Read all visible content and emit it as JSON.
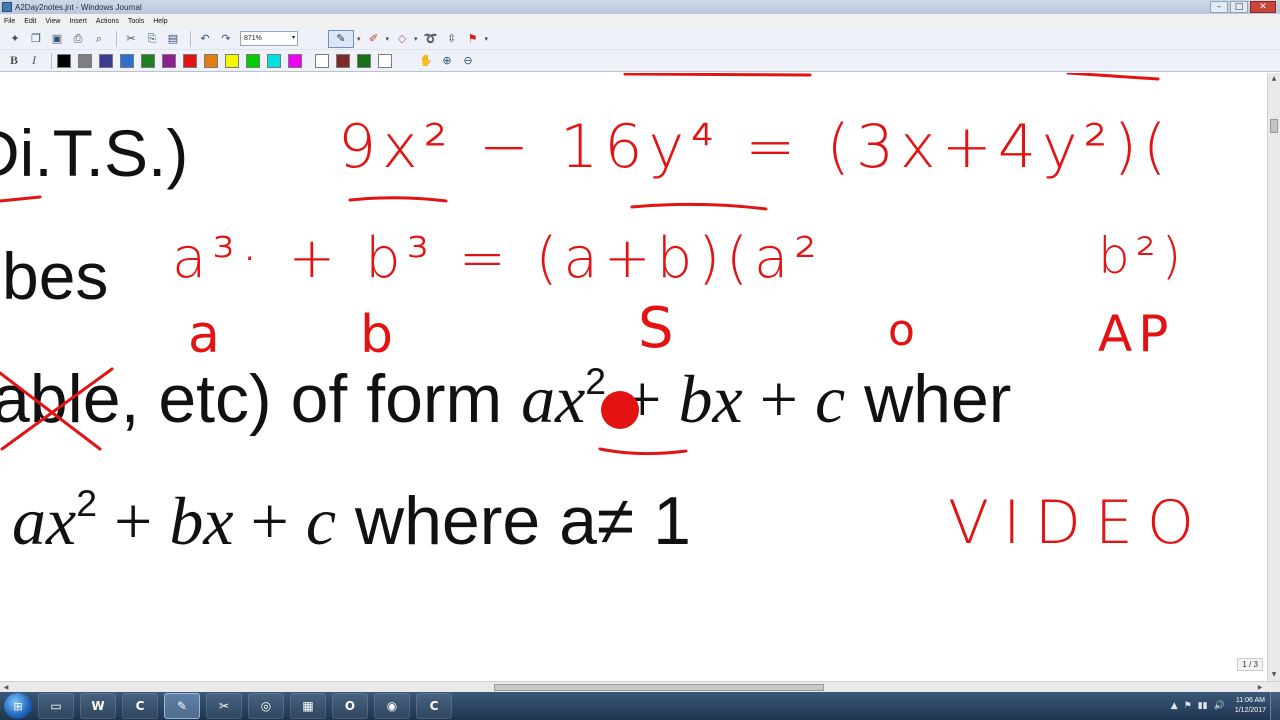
{
  "window": {
    "title": "A2Day2notes.jnt - Windows Journal",
    "minimize": "–",
    "maximize": "□",
    "close": "✕"
  },
  "menu": [
    "File",
    "Edit",
    "View",
    "Insert",
    "Actions",
    "Tools",
    "Help"
  ],
  "toolbar": {
    "zoom": "871%",
    "zoom_arrow": "▾",
    "bold": "B",
    "italic": "I",
    "colors": [
      "#000000",
      "#7f7f7f",
      "#3b3b8f",
      "#2f6fcf",
      "#1f7f1f",
      "#8f1f8f",
      "#e31313",
      "#e07f10",
      "#f5f500",
      "#00d000",
      "#00e0e0",
      "#f000f0",
      "#ffffff",
      "#7f2a2a",
      "#1a6f1a",
      "#ffffff"
    ]
  },
  "canvas": {
    "typed": {
      "line1": "Di.T.S.)",
      "line2": "bes",
      "line3_text": "able, etc) of form ",
      "line3_a": "a",
      "line3_x": "x",
      "line3_exp": "2",
      "line3_plus1": " + ",
      "line3_bx": "bx",
      "line3_plus2": " + ",
      "line3_c": "c",
      "line3_where": " wher",
      "line4_ax": "ax",
      "line4_exp": "2",
      "line4_plus1": " + ",
      "line4_bx": "bx",
      "line4_plus2": " + ",
      "line4_c": "c",
      "line4_where": " where a≠ 1"
    },
    "ink": {
      "dots_eq": "9x² − 16y⁴ = (3x+4y²)(",
      "cubes_eq": "a³· + b³ = (a+b)(a²",
      "cubes_tail": "b²)",
      "label_a": "a",
      "label_b": "b",
      "label_s": "S",
      "label_o": "o",
      "label_ap": "AP",
      "video": "VIDEO"
    },
    "page_indicator": "1 / 3"
  },
  "scrollbars": {
    "up": "▲",
    "down": "▼",
    "left": "◀",
    "right": "▶"
  },
  "taskbar": {
    "start": "⊞",
    "apps": [
      {
        "name": "file-explorer",
        "label": "▭"
      },
      {
        "name": "word",
        "label": "W"
      },
      {
        "name": "camtasia",
        "label": "C"
      },
      {
        "name": "windows-journal",
        "label": "✎"
      },
      {
        "name": "snipping-tool",
        "label": "✂"
      },
      {
        "name": "calculator",
        "label": "◎"
      },
      {
        "name": "tablet-tool",
        "label": "▦"
      },
      {
        "name": "outlook",
        "label": "O"
      },
      {
        "name": "chrome",
        "label": "◉"
      },
      {
        "name": "camtasia-recorder",
        "label": "C"
      }
    ],
    "tray": [
      "▲",
      "⚑",
      "▮▮",
      "🔊"
    ],
    "time": "11:06 AM",
    "date": "1/12/2017"
  }
}
